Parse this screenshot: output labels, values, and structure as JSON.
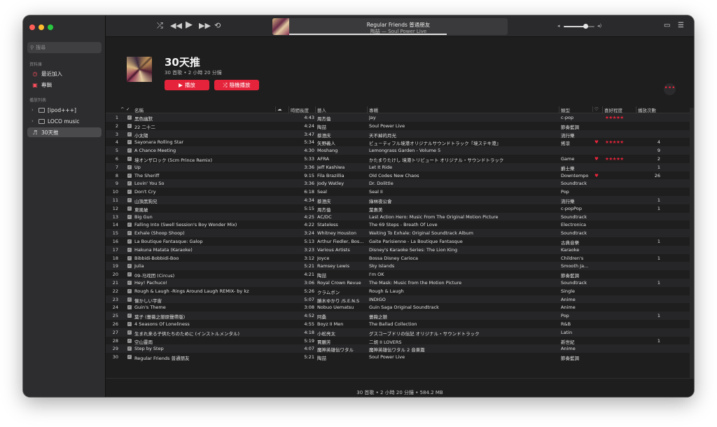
{
  "sidebar": {
    "search_placeholder": "搜尋",
    "library_title": "資料庫",
    "library_items": [
      {
        "label": "最近加入",
        "icon": "clock-icon"
      },
      {
        "label": "專輯",
        "icon": "album-icon"
      }
    ],
    "playlists_title": "播放列表",
    "playlists": [
      {
        "label": "[ipod+++]"
      },
      {
        "label": "LOCO music"
      },
      {
        "label": "30天推"
      }
    ]
  },
  "now_playing": {
    "title": "Regular Friends 普通朋友",
    "subtitle": "陶喆 — Soul Power Live",
    "progress": 0.72
  },
  "volume": 0.7,
  "playlist": {
    "title": "30天推",
    "meta": "30 首歌 • 2 小時 20 分鐘",
    "play_label": "播放",
    "shuffle_label": "隨機播放",
    "more_label": "•••"
  },
  "columns": {
    "name": "名稱",
    "time": "時間長度",
    "artist": "藝人",
    "album": "專輯",
    "genre": "類型",
    "love": "♡",
    "rating": "喜好程度",
    "plays": "播放次數"
  },
  "tracks": [
    {
      "n": "1",
      "name": "黑色幽默",
      "time": "4:43",
      "artist": "周杰倫",
      "album": "Jay",
      "genre": "c-pop",
      "loved": "",
      "stars": "★★★★★",
      "plays": ""
    },
    {
      "n": "2",
      "name": "22 二十二",
      "time": "4:24",
      "artist": "陶喆",
      "album": "Soul Power Live",
      "genre": "節奏藍調",
      "loved": "",
      "stars": "",
      "plays": ""
    },
    {
      "n": "3",
      "name": "小太陽",
      "time": "3:47",
      "artist": "蔡澄庆",
      "album": "天不掉的月光",
      "genre": "流行樂",
      "loved": "",
      "stars": "",
      "plays": ""
    },
    {
      "n": "4",
      "name": "Sayonara Rolling Star",
      "time": "5:34",
      "artist": "矢野義人",
      "album": "ビュ－ティフル境港オリジナルサウンドトラック『境ステキ港』",
      "genre": "搖滾",
      "loved": "♥",
      "stars": "★★★★★",
      "plays": "4"
    },
    {
      "n": "5",
      "name": "A Chance Meeting",
      "time": "4:30",
      "artist": "Moshang",
      "album": "Lemongrass Garden - Volume 5",
      "genre": "",
      "loved": "",
      "stars": "",
      "plays": "9"
    },
    {
      "n": "6",
      "name": "境オンザロック (5cm Prince Remix)",
      "time": "5:33",
      "artist": "AFRA",
      "album": "かたまりたけし 境港トリビュート オリジナル・サウンドトラック",
      "genre": "Game",
      "loved": "♥",
      "stars": "★★★★★",
      "plays": "2"
    },
    {
      "n": "7",
      "name": "Up",
      "time": "3:36",
      "artist": "Jeff Kashiwa",
      "album": "Let It Ride",
      "genre": "爵士樂",
      "loved": "",
      "stars": "",
      "plays": "1"
    },
    {
      "n": "8",
      "name": "The Sheriff",
      "time": "9:15",
      "artist": "Fila Brazillia",
      "album": "Old Codes New Chaos",
      "genre": "Downtempo",
      "loved": "♥",
      "stars": "",
      "plays": "26"
    },
    {
      "n": "9",
      "name": "Lovin' You So",
      "time": "3:36",
      "artist": "Jody Watley",
      "album": "Dr. Dolittle",
      "genre": "Soundtrack",
      "loved": "",
      "stars": "",
      "plays": ""
    },
    {
      "n": "10",
      "name": "Don't Cry",
      "time": "6:18",
      "artist": "Seal",
      "album": "Seal II",
      "genre": "Pop",
      "loved": "",
      "stars": "",
      "plays": ""
    },
    {
      "n": "11",
      "name": "山頂黑狗兄",
      "time": "4:34",
      "artist": "蔡澄庆",
      "album": "綠林夜公會",
      "genre": "流行樂",
      "loved": "",
      "stars": "",
      "plays": "1"
    },
    {
      "n": "12",
      "name": "東風破",
      "time": "5:15",
      "artist": "周杰倫",
      "album": "葉惠美",
      "genre": "c-popPop",
      "loved": "",
      "stars": "",
      "plays": "1"
    },
    {
      "n": "13",
      "name": "Big Gun",
      "time": "4:25",
      "artist": "AC/DC",
      "album": "Last Action Hero: Music From The Original Motion Picture",
      "genre": "Soundtrack",
      "loved": "",
      "stars": "",
      "plays": ""
    },
    {
      "n": "14",
      "name": "Falling Into (Swell Session's Boy Wonder Mix)",
      "time": "4:22",
      "artist": "Stateless",
      "album": "The 69 Steps - Breath Of Love",
      "genre": "Electronica",
      "loved": "",
      "stars": "",
      "plays": ""
    },
    {
      "n": "15",
      "name": "Exhale (Shoop Shoop)",
      "time": "3:24",
      "artist": "Whitney Houston",
      "album": "Waiting To Exhale: Original Soundtrack Album",
      "genre": "Soundtrack",
      "loved": "",
      "stars": "",
      "plays": ""
    },
    {
      "n": "16",
      "name": "La Boutique Fantasque: Galop",
      "time": "5:13",
      "artist": "Arthur Fiedler, Bos...",
      "album": "Gaite Parisienne - La Boutique Fantasque",
      "genre": "古典音樂",
      "loved": "",
      "stars": "",
      "plays": "1"
    },
    {
      "n": "17",
      "name": "Hakuna Matata (Karaoke)",
      "time": "3:23",
      "artist": "Various Artists",
      "album": "Disney's Karaoke Series: The Lion King",
      "genre": "Karaoke",
      "loved": "",
      "stars": "",
      "plays": ""
    },
    {
      "n": "18",
      "name": "Bibbidi-Bobbidi-Boo",
      "time": "3:12",
      "artist": "Joyce",
      "album": "Bossa Disney Carioca",
      "genre": "Children's",
      "loved": "",
      "stars": "",
      "plays": "1"
    },
    {
      "n": "19",
      "name": "Julia",
      "time": "5:21",
      "artist": "Ramsey Lewis",
      "album": "Sky Islands",
      "genre": "Smooth Ja...",
      "loved": "",
      "stars": "",
      "plays": ""
    },
    {
      "n": "20",
      "name": "09-马戏团 (Circus)",
      "time": "4:21",
      "artist": "陶喆",
      "album": "I'm OK",
      "genre": "節奏藍調",
      "loved": "",
      "stars": "",
      "plays": ""
    },
    {
      "n": "21",
      "name": "Hey! Pachuco!",
      "time": "3:06",
      "artist": "Royal Crown Revue",
      "album": "The Mask: Music from the Motion Picture",
      "genre": "Soundtrack",
      "loved": "",
      "stars": "",
      "plays": "1"
    },
    {
      "n": "22",
      "name": "Rough & Laugh -Rings Around Laugh REMIX- by kz",
      "time": "5:26",
      "artist": "クラムボン",
      "album": "Rough & Laugh",
      "genre": "Single",
      "loved": "",
      "stars": "",
      "plays": ""
    },
    {
      "n": "23",
      "name": "懐かしい宇宙",
      "time": "5:07",
      "artist": "勝木ゆかり /S.E.N.S",
      "album": "INDIGO",
      "genre": "Anime",
      "loved": "",
      "stars": "",
      "plays": ""
    },
    {
      "n": "24",
      "name": "Guin's Theme",
      "time": "3:08",
      "artist": "Nobuo Uematsu",
      "album": "Guin Saga Original Soundtrack",
      "genre": "Anime",
      "loved": "",
      "stars": "",
      "plays": ""
    },
    {
      "n": "25",
      "name": "葉子 (薔薇之戀原聲帶版)",
      "time": "4:52",
      "artist": "阿桑",
      "album": "薔薇之戀",
      "genre": "Pop",
      "loved": "",
      "stars": "",
      "plays": "1"
    },
    {
      "n": "26",
      "name": "4 Seasons Of Loneliness",
      "time": "4:55",
      "artist": "Boyz II Men",
      "album": "The Ballad Collection",
      "genre": "R&B",
      "loved": "",
      "stars": "",
      "plays": ""
    },
    {
      "n": "27",
      "name": "生まれ来る子供たちのために (インストルメンタル)",
      "time": "4:18",
      "artist": "小松亮太",
      "album": "グスコーブドリの伝記 オリジナル・サウンドトラック",
      "genre": "Latin",
      "loved": "",
      "stars": "",
      "plays": ""
    },
    {
      "n": "28",
      "name": "空山靈雨",
      "time": "5:19",
      "artist": "賈鵬芳",
      "album": "二胡 II LOVERS",
      "genre": "新世紀",
      "loved": "",
      "stars": "",
      "plays": "1"
    },
    {
      "n": "29",
      "name": "Step by Step",
      "time": "4:07",
      "artist": "魔神英雄伝ワタル",
      "album": "魔神英雄伝ワタル 2 音楽篇",
      "genre": "Anime",
      "loved": "",
      "stars": "",
      "plays": ""
    },
    {
      "n": "30",
      "name": "Regular Friends 普通朋友",
      "time": "5:21",
      "artist": "陶喆",
      "album": "Soul Power Live",
      "genre": "節奏藍調",
      "loved": "",
      "stars": "",
      "plays": ""
    }
  ],
  "footer": "30 首歌 • 2 小時 20 分鐘 • 584.2 MB",
  "colors": {
    "accent": "#e5243b",
    "background": "#1e1e1e",
    "sidebar": "#2d2d2f"
  }
}
